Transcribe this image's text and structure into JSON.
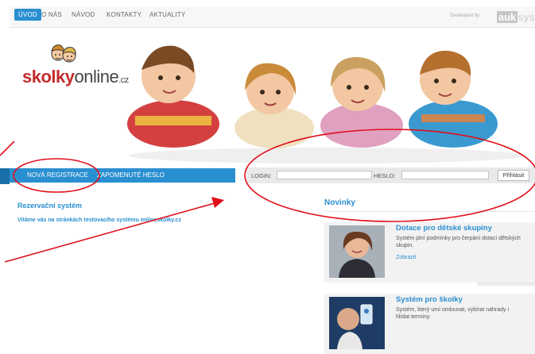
{
  "nav": {
    "items": [
      {
        "label": "ÚVOD",
        "active": true
      },
      {
        "label": "O NÁS",
        "active": false
      },
      {
        "label": "NÁVOD",
        "active": false
      },
      {
        "label": "KONTAKTY",
        "active": false
      },
      {
        "label": "AKTUALITY",
        "active": false
      }
    ],
    "developed_by": "Developed by",
    "dev_logo_a": "auk",
    "dev_logo_b": "sys"
  },
  "logo": {
    "brand_a": "skolky",
    "brand_b": "online",
    "brand_c": ".cz"
  },
  "bar": {
    "register": "NOVÁ REGISTRACE",
    "forgot": "ZAPOMENUTÉ HESLO"
  },
  "login": {
    "login_label": "LOGIN:",
    "password_label": "HESLO:",
    "submit": "Přihlásit"
  },
  "left": {
    "heading": "Rezervační systém",
    "welcome": "Vitáme vás na stránkách testovacího systému onlineskolky.cz"
  },
  "news": {
    "heading": "Novinky",
    "items": [
      {
        "title": "Dotace pro dětské skupiny",
        "text": "Systém plní podmínky pro čerpání dotací dětských skupin.",
        "link": "Zobrazit"
      },
      {
        "title": "Systém pro školky",
        "text": "Systém, který umí omlouvat, vybírat náhrady i hlídat termíny.",
        "link": ""
      }
    ]
  },
  "colors": {
    "accent": "#2a8fd0",
    "brand_red": "#c52b2b",
    "annotation": "#e0101a"
  }
}
